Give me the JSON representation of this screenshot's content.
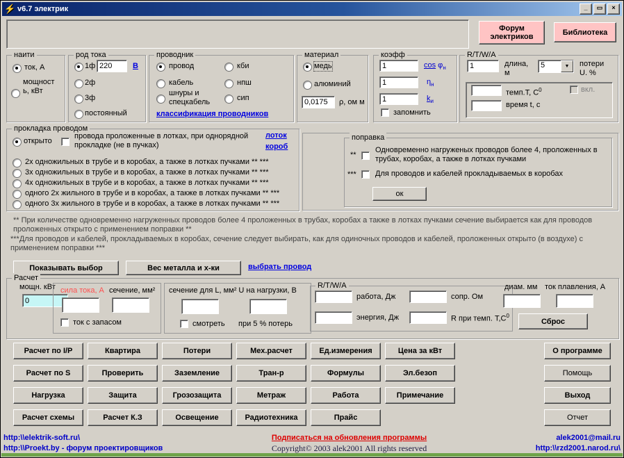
{
  "window": {
    "title": "v6.7 электрик",
    "minimize": "_",
    "maximize": "▭",
    "close": "×"
  },
  "colors": {
    "accent_pink": "#ffc4c4",
    "field_cyan": "#c6f6f6",
    "link_blue": "#0000e0",
    "alert_red": "#ff5050",
    "footer_blue": "#0000c8",
    "subscribe_red": "#dd0000",
    "titlebar_start": "#0a246a",
    "titlebar_end": "#a6caf0",
    "bottom_strip": "#6fa44b"
  },
  "header": {
    "forum_button": "Форум электриков",
    "library_button": "Библиотека"
  },
  "find_group": {
    "title": "наити",
    "opt_current": "ток, А",
    "opt_power": "мощность, кВт"
  },
  "current_type_group": {
    "title": "род тока",
    "opt_1ph": "1ф",
    "voltage_value": "220",
    "voltage_link": "В",
    "opt_2ph": "2ф",
    "opt_3ph": "3ф",
    "opt_dc": "постоянный"
  },
  "conductor_group": {
    "title": "проводник",
    "opt_wire": "провод",
    "opt_cable": "кабель",
    "opt_cords": "шнуры и спецкабель",
    "opt_kbi": "кби",
    "opt_npsh": "нпш",
    "opt_sip": "сип",
    "classification_link": "классификация проводников"
  },
  "material_group": {
    "title": "материал",
    "opt_copper": "медь",
    "opt_aluminum": "алюминий",
    "resistivity_value": "0,0175",
    "resistivity_label": "ρ, ом м"
  },
  "coeff_group": {
    "title": "коэфф",
    "rows": [
      {
        "value": "1",
        "u": "cos",
        "m": " φ",
        "s": "н"
      },
      {
        "value": "1",
        "u": "",
        "m": "η",
        "s": "н"
      },
      {
        "value": "1",
        "u": "k",
        "m": "",
        "s": "и"
      }
    ],
    "remember_label": "запомнить"
  },
  "rtwa_group": {
    "title": "R/T/W/A",
    "length_value": "1",
    "length_label": "длина, м",
    "loss_value": "5",
    "loss_label": "потери U. %",
    "temp_label": "темп.T, C",
    "temp_sup": "0",
    "on_label": "вкл.",
    "time_label": "время t, с"
  },
  "laying_group": {
    "title": "прокладка проводом",
    "opt_open": "открыто",
    "tray_check_label": "провода проложенные в лотках, при однорядной прокладке (не в пучках)",
    "tray_link": "лоток",
    "duct_link": "короб",
    "options": [
      "2х одножильных в трубе и в коробах, а также в лотках пучками ** ***",
      "3х одножильных в трубе и в коробах, а также в лотках пучками ** ***",
      "4х одножильных в трубе и в коробах, а также в лотках пучками ** ***",
      "одного 2х жильного в трубе и в коробах, а также в лотках пучками ** ***",
      "одного 3х жильного в трубе и в коробах, а также в лотках пучками ** ***"
    ]
  },
  "correction_group": {
    "title": "поправка",
    "item1_marker": "**",
    "item1_label": "Одновременно нагруженых проводов более 4, проложенных в трубах, коробах, а также в лотках пучками",
    "item2_marker": "***",
    "item2_label": "Для проводов и кабелей прокладываемых в коробах",
    "ok_button": "ок"
  },
  "notes": {
    "note1": "** При количестве одновременно нагруженных проводов более 4 проложенных в трубах, коробах а также в лотках пучками сечение выбирается как для проводов проложенных открыто с применением поправки **",
    "note2": "***Для проводов и кабелей, прокладываемых в коробах, сечение следует выбирать, как для одиночных проводов и кабелей, проложенных открыто (в воздухе) с применением поправки ***"
  },
  "actions": {
    "show_button": "Показывать выбор",
    "weight_button": "Вес металла и х-ки",
    "choose_link": "выбрать провод"
  },
  "calc_group": {
    "title": "Расчет",
    "power_label": "мощн. кВт",
    "power_value": "0",
    "current_panel": {
      "current_label": "сила тока, А",
      "section_label": "сечение, мм²",
      "reserve_label": "ток с запасом"
    },
    "section_panel": {
      "header": "сечение для L, мм² U на нагрузки, В",
      "watch_label": "смотреть",
      "loss_label": "при 5 % потерь"
    },
    "rtwa_panel": {
      "title": "R/T/W/A",
      "work_label": "работа, Дж",
      "resistance_label": "сопр. Ом",
      "energy_label": "энергия, Дж",
      "r_temp_label": "R при темп. T,C",
      "r_temp_sup": "0"
    },
    "diameter_label": "диам. мм",
    "melting_label": "ток плавления, А",
    "reset_button": "Сброс"
  },
  "grid_buttons": {
    "row1": [
      "Расчет по I/P",
      "Квартира",
      "Потери",
      "Мех.расчет",
      "Ед.измерения",
      "Цена за кВт"
    ],
    "row2": [
      "Расчет по S",
      "Проверить",
      "Заземление",
      "Тран-р",
      "Формулы",
      "Эл.безоп"
    ],
    "row3": [
      "Нагрузка",
      "Защита",
      "Грозозащита",
      "Метраж",
      "Работа",
      "Примечание"
    ],
    "row4": [
      "Расчет схемы",
      "Расчет К.З",
      "Освещение",
      "Радиотехника",
      "Прайс"
    ]
  },
  "side_buttons": {
    "about": "О программе",
    "help": "Помощь",
    "exit": "Выход",
    "report": "Отчет"
  },
  "footer": {
    "site1": "http:\\\\elektrik-soft.ru\\",
    "subscribe": "Подписаться на обновления программы",
    "email": "alek2001@mail.ru",
    "site2": "http:\\\\Proekt.by - форум проектировщиков",
    "copyright": "Copyright© 2003 alek2001 All rights reserved",
    "site3": "http:\\\\rzd2001.narod.ru\\"
  }
}
